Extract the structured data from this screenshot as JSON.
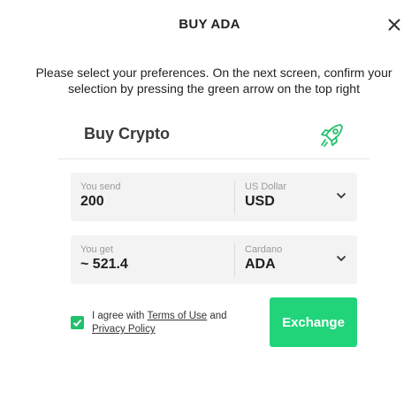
{
  "dialog": {
    "title": "BUY ADA",
    "close_icon": "close-icon",
    "intro": "Please select your preferences. On the next screen, confirm your selection by pressing the green arrow on the top right",
    "heading": "Buy Crypto",
    "rocket_icon": "rocket-icon"
  },
  "send": {
    "label": "You send",
    "value": "200",
    "currency_label": "US Dollar",
    "currency_code": "USD"
  },
  "get": {
    "label": "You get",
    "value": "~ 521.4",
    "currency_label": "Cardano",
    "currency_code": "ADA"
  },
  "terms": {
    "checked": true,
    "prefix": "I agree with ",
    "terms_link": "Terms of Use",
    "middle": " and",
    "privacy_link": "Privacy Policy"
  },
  "actions": {
    "exchange_label": "Exchange"
  },
  "colors": {
    "accent": "#21d47a",
    "checkbox": "#21c06b",
    "field_bg": "#f3f3f3"
  }
}
